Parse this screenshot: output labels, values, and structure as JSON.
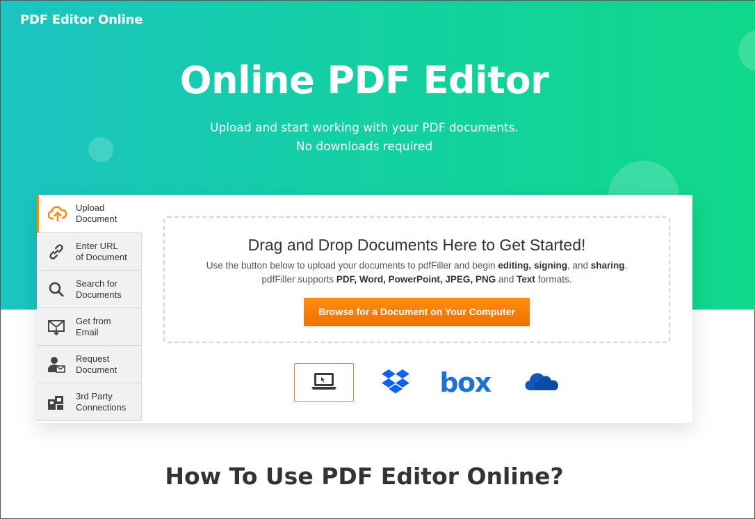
{
  "header": {
    "brand": "PDF Editor Online"
  },
  "hero": {
    "title": "Online PDF Editor",
    "subtitle_line1": "Upload and start working with your PDF documents.",
    "subtitle_line2": "No downloads required"
  },
  "sidebar": {
    "items": [
      {
        "line1": "Upload",
        "line2": "Document",
        "icon": "cloud-upload-icon",
        "active": true
      },
      {
        "line1": "Enter URL",
        "line2": "of Document",
        "icon": "link-icon"
      },
      {
        "line1": "Search for",
        "line2": "Documents",
        "icon": "search-icon"
      },
      {
        "line1": "Get from",
        "line2": "Email",
        "icon": "email-icon"
      },
      {
        "line1": "Request",
        "line2": "Document",
        "icon": "request-user-icon"
      },
      {
        "line1": "3rd Party",
        "line2": "Connections",
        "icon": "connections-icon"
      }
    ]
  },
  "dropzone": {
    "title": "Drag and Drop Documents Here to Get Started!",
    "line1_prefix": "Use the button below to upload your documents to pdfFiller and begin ",
    "line1_b1": "editing,",
    "line1_b2": "signing",
    "line1_mid": ", and ",
    "line1_b3": "sharing",
    "line1_suffix": ".",
    "line2_prefix": "pdfFiller supports ",
    "line2_b1": "PDF, Word, PowerPoint, JPEG, PNG",
    "line2_mid": " and ",
    "line2_b2": "Text",
    "line2_suffix": " formats.",
    "button": "Browse for a Document on Your Computer"
  },
  "sources": {
    "items": [
      "computer-icon",
      "dropbox-icon",
      "box-icon",
      "onedrive-icon"
    ],
    "box_text": "box"
  },
  "colors": {
    "accent": "#ff8a00",
    "hero_start": "#1cc4c2",
    "hero_end": "#0fd88a",
    "dropbox": "#0d62f5",
    "box": "#1b75d0",
    "onedrive": "#1457b8"
  },
  "section": {
    "title": "How To Use PDF Editor Online?"
  }
}
